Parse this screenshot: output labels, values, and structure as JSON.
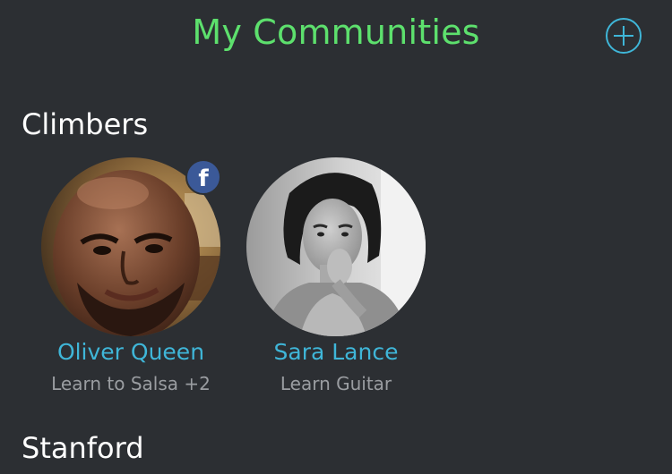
{
  "header": {
    "title": "My Communities",
    "add_icon": "plus-circle-icon"
  },
  "communities": [
    {
      "name": "Climbers",
      "members": [
        {
          "name": "Oliver Queen",
          "subtitle": "Learn to Salsa +2",
          "badge_icon": "facebook-icon",
          "badge_label": "f"
        },
        {
          "name": "Sara Lance",
          "subtitle": "Learn Guitar"
        }
      ]
    },
    {
      "name": "Stanford",
      "members": []
    }
  ],
  "colors": {
    "background": "#2c2f33",
    "title_green": "#5de06d",
    "accent_blue": "#3fb6d8",
    "subtitle_gray": "#9a9da1",
    "facebook_blue": "#3b5998"
  }
}
